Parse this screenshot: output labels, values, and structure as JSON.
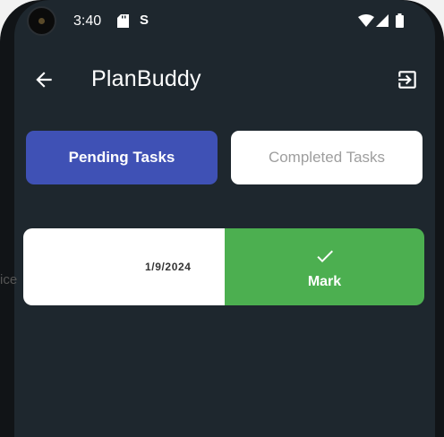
{
  "status_bar": {
    "time": "3:40",
    "icons": [
      "sd-card-icon",
      "sync-icon",
      "wifi-icon",
      "signal-icon",
      "battery-icon"
    ]
  },
  "app_bar": {
    "title": "PlanBuddy",
    "back_icon": "arrow-left-icon",
    "logout_icon": "exit-icon"
  },
  "tabs": [
    {
      "label": "Pending Tasks",
      "active": true
    },
    {
      "label": "Completed Tasks",
      "active": false
    }
  ],
  "tasks": [
    {
      "title_fragment": "ice",
      "date": "1/9/2024",
      "action_label": "Mark",
      "action_icon": "check-icon"
    }
  ],
  "colors": {
    "background": "#1e272e",
    "active_tab": "#3f51b5",
    "mark_action": "#4caf50"
  }
}
